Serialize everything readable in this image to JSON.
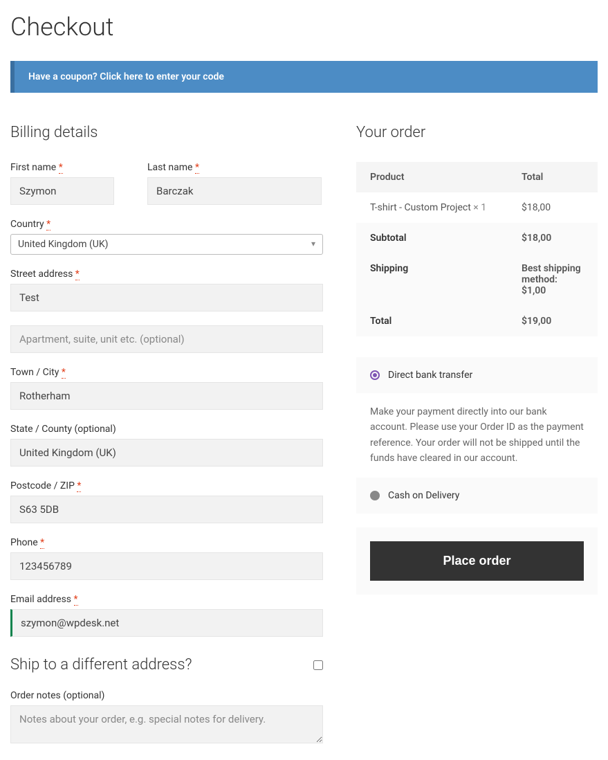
{
  "page_title": "Checkout",
  "coupon": {
    "prompt": "Have a coupon?",
    "action": "Click here to enter your code"
  },
  "billing": {
    "heading": "Billing details",
    "first_name_label": "First name",
    "first_name_value": "Szymon",
    "last_name_label": "Last name",
    "last_name_value": "Barczak",
    "country_label": "Country",
    "country_value": "United Kingdom (UK)",
    "street_label": "Street address",
    "street_value": "Test",
    "apt_placeholder": "Apartment, suite, unit etc. (optional)",
    "city_label": "Town / City",
    "city_value": "Rotherham",
    "state_label": "State / County (optional)",
    "state_value": "United Kingdom (UK)",
    "postcode_label": "Postcode / ZIP",
    "postcode_value": "S63 5DB",
    "phone_label": "Phone",
    "phone_value": "123456789",
    "email_label": "Email address",
    "email_value": "szymon@wpdesk.net"
  },
  "shipping": {
    "heading": "Ship to a different address?",
    "notes_label": "Order notes (optional)",
    "notes_placeholder": "Notes about your order, e.g. special notes for delivery."
  },
  "order": {
    "heading": "Your order",
    "product_header": "Product",
    "total_header": "Total",
    "item_name": "T-shirt - Custom Project ",
    "item_qty": "× 1",
    "item_total": "$18,00",
    "subtotal_label": "Subtotal",
    "subtotal_value": "$18,00",
    "shipping_label": "Shipping",
    "shipping_value": "Best shipping method:\n$1,00",
    "total_label": "Total",
    "total_value": "$19,00"
  },
  "payment": {
    "bank_label": "Direct bank transfer",
    "bank_desc": "Make your payment directly into our bank account. Please use your Order ID as the payment reference. Your order will not be shipped until the funds have cleared in our account.",
    "cod_label": "Cash on Delivery"
  },
  "place_order": "Place order",
  "required_marker": "*"
}
